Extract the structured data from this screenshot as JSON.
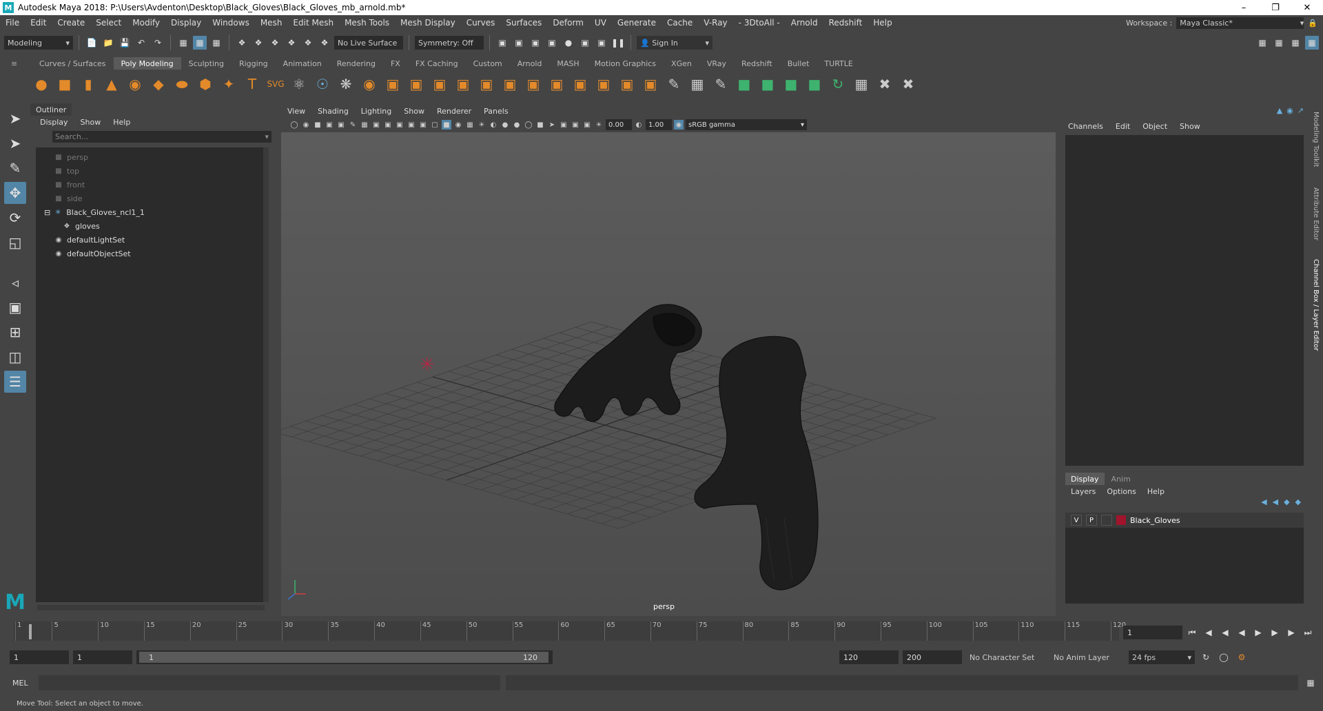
{
  "window": {
    "title": "Autodesk Maya 2018: P:\\Users\\Avdenton\\Desktop\\Black_Gloves\\Black_Gloves_mb_arnold.mb*",
    "logo": "M"
  },
  "menu": [
    "File",
    "Edit",
    "Create",
    "Select",
    "Modify",
    "Display",
    "Windows",
    "Mesh",
    "Edit Mesh",
    "Mesh Tools",
    "Mesh Display",
    "Curves",
    "Surfaces",
    "Deform",
    "UV",
    "Generate",
    "Cache",
    "V-Ray",
    "- 3DtoAll -",
    "Arnold",
    "Redshift",
    "Help"
  ],
  "workspace": {
    "label": "Workspace :",
    "value": "Maya Classic*"
  },
  "status_line": {
    "mode": "Modeling",
    "live_surface": "No Live Surface",
    "symmetry": "Symmetry: Off",
    "sign_in": "Sign In"
  },
  "shelf_tabs": [
    "Curves / Surfaces",
    "Poly Modeling",
    "Sculpting",
    "Rigging",
    "Animation",
    "Rendering",
    "FX",
    "FX Caching",
    "Custom",
    "Arnold",
    "MASH",
    "Motion Graphics",
    "XGen",
    "VRay",
    "Redshift",
    "Bullet",
    "TURTLE"
  ],
  "shelf_active": "Poly Modeling",
  "outliner": {
    "title": "Outliner",
    "menu": [
      "Display",
      "Show",
      "Help"
    ],
    "search_placeholder": "Search...",
    "items": [
      {
        "label": "persp",
        "icon": "camera-icon",
        "dim": true
      },
      {
        "label": "top",
        "icon": "camera-icon",
        "dim": true
      },
      {
        "label": "front",
        "icon": "camera-icon",
        "dim": true
      },
      {
        "label": "side",
        "icon": "camera-icon",
        "dim": true
      },
      {
        "label": "Black_Gloves_ncl1_1",
        "icon": "transform-icon",
        "dim": false
      },
      {
        "label": "gloves",
        "icon": "mesh-icon",
        "dim": false
      },
      {
        "label": "defaultLightSet",
        "icon": "set-icon",
        "dim": false
      },
      {
        "label": "defaultObjectSet",
        "icon": "set-icon",
        "dim": false
      }
    ]
  },
  "viewport": {
    "menu": [
      "View",
      "Shading",
      "Lighting",
      "Show",
      "Renderer",
      "Panels"
    ],
    "exposure": "0.00",
    "gamma": "1.00",
    "color_space": "sRGB gamma",
    "camera_label": "persp"
  },
  "channel_box": {
    "menu": [
      "Channels",
      "Edit",
      "Object",
      "Show"
    ]
  },
  "layer_editor": {
    "tabs": [
      "Display",
      "Anim"
    ],
    "menu": [
      "Layers",
      "Options",
      "Help"
    ],
    "layer": {
      "v": "V",
      "p": "P",
      "name": "Black_Gloves",
      "color": "#a0142c"
    }
  },
  "side_tabs": [
    "Modeling Toolkit",
    "Attribute Editor",
    "Channel Box / Layer Editor"
  ],
  "time_slider": {
    "ticks": [
      "1",
      "5",
      "10",
      "15",
      "20",
      "25",
      "30",
      "35",
      "40",
      "45",
      "50",
      "55",
      "60",
      "65",
      "70",
      "75",
      "80",
      "85",
      "90",
      "95",
      "100",
      "105",
      "110",
      "115",
      "120"
    ],
    "current_frame": "1"
  },
  "range": {
    "start": "1",
    "inner_start": "1",
    "slider_start": "1",
    "slider_end": "120",
    "end": "120",
    "anim_end": "200",
    "char_set": "No Character Set",
    "anim_layer": "No Anim Layer",
    "fps": "24 fps"
  },
  "command": {
    "lang": "MEL"
  },
  "help_line": "Move Tool: Select an object to move."
}
